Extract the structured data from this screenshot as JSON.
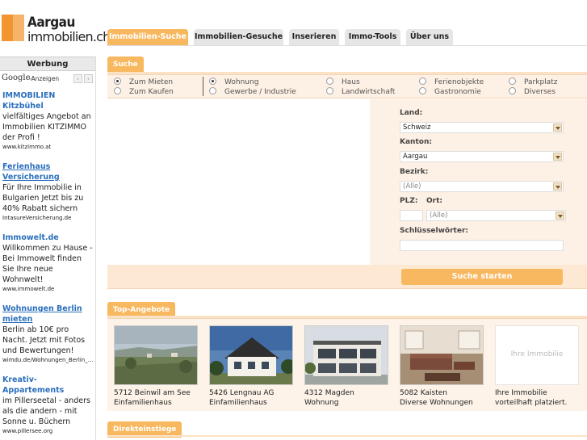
{
  "logo": {
    "line1": "Aargau",
    "line2": "immobilien.ch"
  },
  "ads": {
    "header": "Werbung",
    "google_label": "Google",
    "google_suffix": "-Anzeigen",
    "prev_icon": "‹",
    "next_icon": "›",
    "items": [
      {
        "title": "IMMOBILIEN Kitzbühel",
        "desc": "vielfältiges Angebot an Immobilien KITZIMMO der Profi !",
        "url": "www.kitzimmo.at"
      },
      {
        "title": "Ferienhaus Versicherung",
        "desc": "Für Ihre Immobilie in Bulgarien Jetzt bis zu 40% Rabatt sichern",
        "url": "IntasureVersicherung.de"
      },
      {
        "title": "Immowelt.de",
        "desc": "Willkommen zu Hause - Bei Immowelt finden Sie Ihre neue Wohnwelt!",
        "url": "www.immowelt.de"
      },
      {
        "title": "Wohnungen Berlin mieten",
        "desc": "Berlin ab 10€ pro Nacht. Jetzt mit Fotos und Bewertungen!",
        "url": "wimdu.de/Wohnungen_Berlin_..."
      },
      {
        "title": "Kreativ-Appartements",
        "desc": "im Pillerseetal - anders als die andern - mit Sonne u. Büchern",
        "url": "www.pillersee.org"
      }
    ]
  },
  "nav": {
    "tabs": [
      {
        "label": "Immobilien-Suche",
        "active": true
      },
      {
        "label": "Immobilien-Gesuche",
        "active": false
      },
      {
        "label": "Inserieren",
        "active": false
      },
      {
        "label": "Immo-Tools",
        "active": false
      },
      {
        "label": "Über uns",
        "active": false
      }
    ]
  },
  "search": {
    "section_label": "Suche",
    "mode": [
      {
        "label": "Zum Mieten",
        "checked": true
      },
      {
        "label": "Zum Kaufen",
        "checked": false
      }
    ],
    "categories": [
      {
        "label": "Wohnung",
        "checked": true
      },
      {
        "label": "Gewerbe / Industrie",
        "checked": false
      },
      {
        "label": "Haus",
        "checked": false
      },
      {
        "label": "Landwirtschaft",
        "checked": false
      },
      {
        "label": "Ferienobjekte",
        "checked": false
      },
      {
        "label": "Gastronomie",
        "checked": false
      },
      {
        "label": "Parkplatz",
        "checked": false
      },
      {
        "label": "Diverses",
        "checked": false
      }
    ],
    "land_label": "Land:",
    "land_value": "Schweiz",
    "kanton_label": "Kanton:",
    "kanton_value": "Aargau",
    "bezirk_label": "Bezirk:",
    "bezirk_value": "(Alle)",
    "plz_label": "PLZ:",
    "plz_value": "",
    "ort_label": "Ort:",
    "ort_value": "(Alle)",
    "keywords_label": "Schlüsselwörter:",
    "keywords_value": "",
    "submit_label": "Suche starten"
  },
  "top_offers": {
    "section_label": "Top-Angebote",
    "items": [
      {
        "line1": "5712 Beinwil am See",
        "line2": "Einfamilienhaus"
      },
      {
        "line1": "5426 Lengnau AG",
        "line2": "Einfamilienhaus"
      },
      {
        "line1": "4312 Magden",
        "line2": "Wohnung"
      },
      {
        "line1": "5082 Kaisten",
        "line2": "Diverse Wohnungen"
      },
      {
        "line1": "Ihre Immobilie",
        "line2": "vorteilhaft platziert.",
        "placeholder": "Ihre Immobilie"
      }
    ]
  },
  "direct": {
    "section_label": "Direkteinstiege"
  },
  "colors": {
    "accent": "#f8b85f",
    "panel": "#fdf0e4",
    "link": "#2a6fbd"
  }
}
